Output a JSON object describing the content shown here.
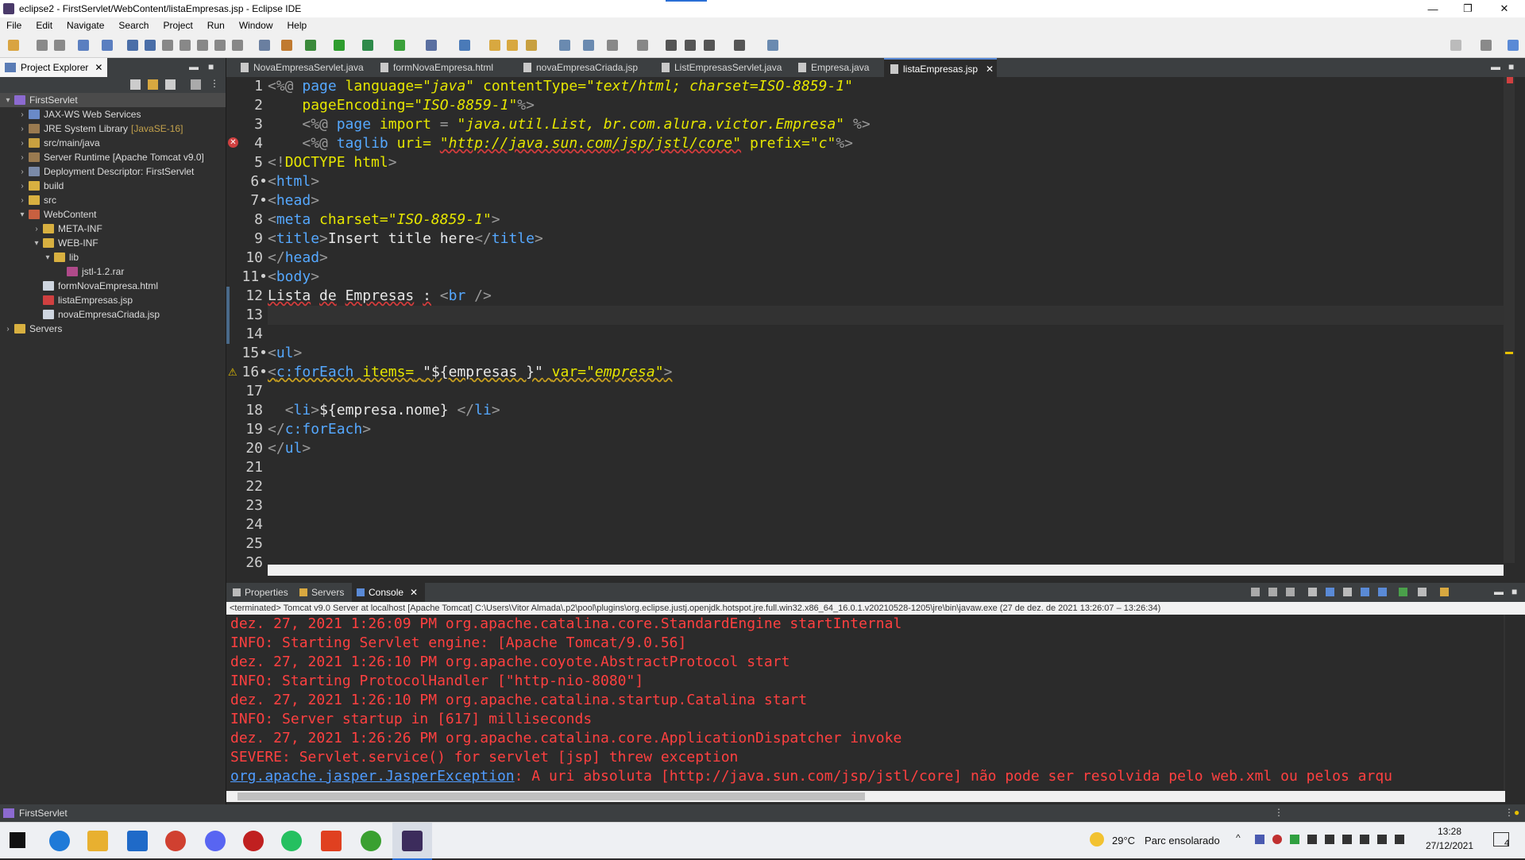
{
  "window": {
    "title": "eclipse2 - FirstServlet/WebContent/listaEmpresas.jsp - Eclipse IDE",
    "controls": [
      "—",
      "❐",
      "✕"
    ]
  },
  "menu": [
    "File",
    "Edit",
    "Navigate",
    "Search",
    "Project",
    "Run",
    "Window",
    "Help"
  ],
  "explorer": {
    "tab_label": "Project Explorer",
    "tree": [
      {
        "label": "FirstServlet",
        "depth": 0,
        "expanded": true,
        "icon": "project-icon",
        "selected": true
      },
      {
        "label": "JAX-WS Web Services",
        "depth": 1,
        "expanded": false,
        "icon": "webservice-icon"
      },
      {
        "label": "JRE System Library",
        "extra": "[JavaSE-16]",
        "depth": 1,
        "expanded": false,
        "icon": "library-icon"
      },
      {
        "label": "src/main/java",
        "depth": 1,
        "expanded": false,
        "icon": "source-folder-icon"
      },
      {
        "label": "Server Runtime [Apache Tomcat v9.0]",
        "depth": 1,
        "expanded": false,
        "icon": "library-icon"
      },
      {
        "label": "Deployment Descriptor: FirstServlet",
        "depth": 1,
        "expanded": false,
        "icon": "descriptor-icon"
      },
      {
        "label": "build",
        "depth": 1,
        "expanded": false,
        "icon": "folder-icon"
      },
      {
        "label": "src",
        "depth": 1,
        "expanded": false,
        "icon": "folder-icon"
      },
      {
        "label": "WebContent",
        "depth": 1,
        "expanded": true,
        "icon": "web-folder-icon"
      },
      {
        "label": "META-INF",
        "depth": 2,
        "expanded": false,
        "icon": "folder-icon"
      },
      {
        "label": "WEB-INF",
        "depth": 2,
        "expanded": true,
        "icon": "folder-icon"
      },
      {
        "label": "lib",
        "depth": 3,
        "expanded": true,
        "icon": "folder-icon"
      },
      {
        "label": "jstl-1.2.rar",
        "depth": 4,
        "leaf": true,
        "icon": "archive-icon"
      },
      {
        "label": "formNovaEmpresa.html",
        "depth": 2,
        "leaf": true,
        "icon": "file-icon"
      },
      {
        "label": "listaEmpresas.jsp",
        "depth": 2,
        "leaf": true,
        "icon": "jsp-error-icon"
      },
      {
        "label": "novaEmpresaCriada.jsp",
        "depth": 2,
        "leaf": true,
        "icon": "file-icon"
      },
      {
        "label": "Servers",
        "depth": 0,
        "expanded": false,
        "icon": "folder-icon"
      }
    ]
  },
  "editor": {
    "tabs": [
      "NovaEmpresaServlet.java",
      "formNovaEmpresa.html",
      "novaEmpresaCriada.jsp",
      "ListEmpresasServlet.java",
      "Empresa.java",
      "listaEmpresas.jsp"
    ],
    "active_tab": "listaEmpresas.jsp",
    "line_numbers": [
      "1",
      "2",
      "3",
      "4",
      "5",
      "6",
      "7",
      "8",
      "9",
      "10",
      "11",
      "12",
      "13",
      "14",
      "15",
      "16",
      "17",
      "18",
      "19",
      "20",
      "21",
      "22",
      "23",
      "24",
      "25",
      "26"
    ],
    "fold_markers": [
      "6",
      "7",
      "11",
      "15",
      "16"
    ]
  },
  "console": {
    "tabs": [
      "Properties",
      "Servers",
      "Console"
    ],
    "active_tab": "Console",
    "status": "<terminated> Tomcat v9.0 Server at localhost [Apache Tomcat] C:\\Users\\Vitor Almada\\.p2\\pool\\plugins\\org.eclipse.justj.openjdk.hotspot.jre.full.win32.x86_64_16.0.1.v20210528-1205\\jre\\bin\\javaw.exe  (27 de dez. de 2021 13:26:07 – 13:26:34)",
    "lines": [
      "dez. 27, 2021 1:26:09 PM org.apache.catalina.core.StandardEngine startInternal",
      "INFO: Starting Servlet engine: [Apache Tomcat/9.0.56]",
      "dez. 27, 2021 1:26:10 PM org.apache.coyote.AbstractProtocol start",
      "INFO: Starting ProtocolHandler [\"http-nio-8080\"]",
      "dez. 27, 2021 1:26:10 PM org.apache.catalina.startup.Catalina start",
      "INFO: Server startup in [617] milliseconds",
      "dez. 27, 2021 1:26:26 PM org.apache.catalina.core.ApplicationDispatcher invoke",
      "SEVERE: Servlet.service() for servlet [jsp] threw exception"
    ],
    "exception_link": "org.apache.jasper.JasperException",
    "exception_message": ": A uri absoluta [http://java.sun.com/jsp/jstl/core] não pode ser resolvida pelo web.xml ou pelos arqu"
  },
  "statusbar": {
    "project": "FirstServlet"
  },
  "taskbar": {
    "weather_temp": "29°C",
    "weather_text": "Parc ensolarado",
    "time": "13:28",
    "date": "27/12/2021",
    "notifications": "4"
  },
  "colors": {
    "accent": "#2a6fd6",
    "error": "#ff4040",
    "link": "#4f9cff",
    "keyword": "#e6e600",
    "tag": "#55a8ff"
  }
}
